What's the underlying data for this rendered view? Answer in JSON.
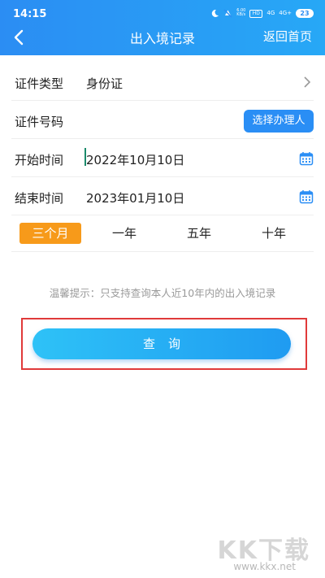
{
  "status": {
    "time": "14:15",
    "icons": [
      "dnd-icon",
      "mute-icon",
      "speed-icon",
      "hd-icon",
      "signal-4g-icon",
      "signal-5g-icon",
      "battery-icon"
    ],
    "speed": "6.00\nKB/s",
    "hd": "HD",
    "net1": "4G",
    "net2": "4G+",
    "battery": "23"
  },
  "nav": {
    "title": "出入境记录",
    "back_icon": "chevron-left-icon",
    "right_label": "返回首页"
  },
  "form": {
    "id_type": {
      "label": "证件类型",
      "value": "身份证"
    },
    "id_number": {
      "label": "证件号码",
      "button": "选择办理人"
    },
    "start": {
      "label": "开始时间",
      "value": "2022年10月10日"
    },
    "end": {
      "label": "结束时间",
      "value": "2023年01月10日"
    }
  },
  "periods": [
    {
      "label": "三个月",
      "active": true
    },
    {
      "label": "一年",
      "active": false
    },
    {
      "label": "五年",
      "active": false
    },
    {
      "label": "十年",
      "active": false
    }
  ],
  "tip": "温馨提示：只支持查询本人近10年内的出入境记录",
  "query_label": "查询",
  "watermark": {
    "brand": "KK下载",
    "url": "www.kkx.net"
  },
  "colors": {
    "header": "#2b8df3",
    "accent_orange": "#f79a1a",
    "button_blue": "#2a8ef5",
    "highlight_red": "#e03a3a"
  }
}
